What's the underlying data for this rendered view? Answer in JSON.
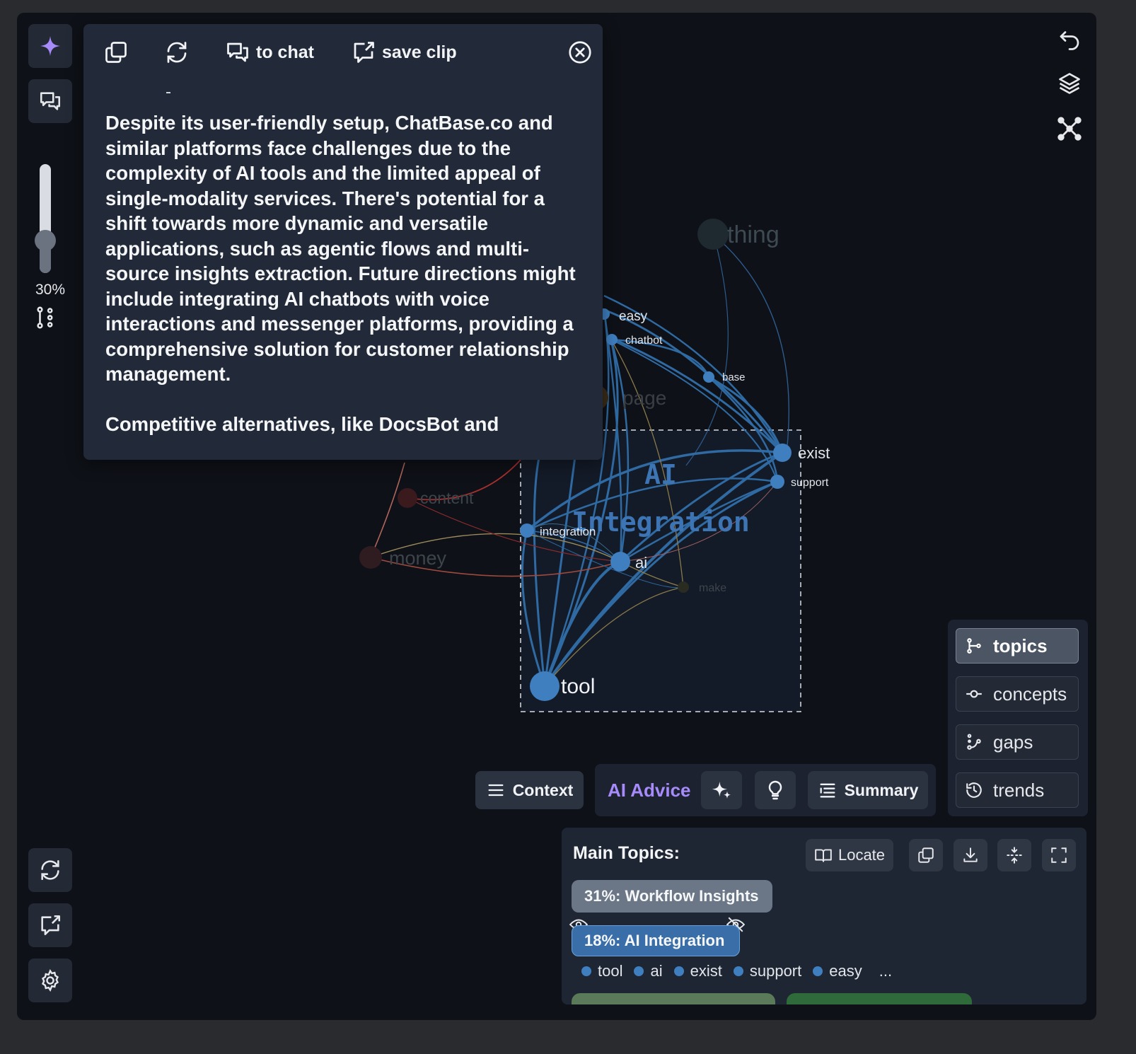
{
  "popup": {
    "to_chat": "to chat",
    "save_clip": "save clip",
    "paragraphs": [
      "Despite its user-friendly setup, ChatBase.co and similar platforms face challenges due to the complexity of AI tools and the limited appeal of single-modality services. There's potential for a shift towards more dynamic and versatile applications, such as agentic flows and multi-source insights extraction. Future directions might include integrating AI chatbots with voice interactions and messenger platforms, providing a comprehensive solution for customer relationship management.",
      "Competitive alternatives, like DocsBot and"
    ]
  },
  "zoom": {
    "label": "30%",
    "value": 0.3
  },
  "graph": {
    "cluster_title": "AI Integration",
    "nodes": {
      "thing": "thing",
      "easy": "easy",
      "chatbot": "chatbot",
      "base": "base",
      "page": "page",
      "exist": "exist",
      "support": "support",
      "content": "content",
      "integration": "integration",
      "money": "money",
      "ai": "ai",
      "make": "make",
      "tool": "tool"
    }
  },
  "toolbar": {
    "context": "Context",
    "ai_advice": "AI Advice",
    "summary": "Summary"
  },
  "views": {
    "topics": "topics",
    "concepts": "concepts",
    "gaps": "gaps",
    "trends": "trends"
  },
  "main_topics": {
    "title": "Main Topics:",
    "locate": "Locate",
    "topic1": "31%: Workflow Insights",
    "topic2": "18%: AI Integration",
    "keywords": [
      "tool",
      "ai",
      "exist",
      "support",
      "easy"
    ],
    "more": "..."
  },
  "colors": {
    "accent_purple": "#a78bfa",
    "node_blue": "#3f7fc0",
    "background": "#0e1117"
  }
}
